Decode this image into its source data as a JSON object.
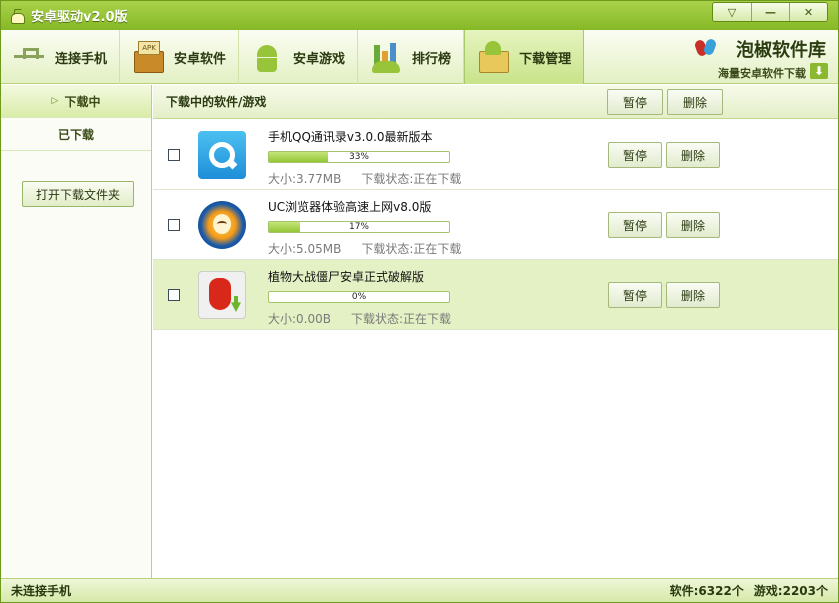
{
  "window": {
    "title": "安卓驱动v2.0版",
    "controls": [
      "▽",
      "—",
      "✕"
    ]
  },
  "toolbar": {
    "items": [
      {
        "label": "连接手机",
        "icon": "usb-icon"
      },
      {
        "label": "安卓软件",
        "icon": "apk-box-icon"
      },
      {
        "label": "安卓游戏",
        "icon": "android-game-icon"
      },
      {
        "label": "排行榜",
        "icon": "ranking-icon"
      },
      {
        "label": "下载管理",
        "icon": "download-folder-icon",
        "active": true
      }
    ]
  },
  "brand": {
    "name": "泡椒软件库",
    "tagline": "海量安卓软件下载",
    "download_glyph": "⬇"
  },
  "sidebar": {
    "arrow": "▷",
    "tabs": [
      {
        "label": "下载中",
        "active": true
      },
      {
        "label": "已下载",
        "active": false
      }
    ],
    "open_folder_label": "打开下载文件夹"
  },
  "main": {
    "title": "下载中的软件/游戏",
    "pause_label": "暂停",
    "delete_label": "删除",
    "downloads": [
      {
        "name": "手机QQ通讯录v3.0.0最新版本",
        "progress": 33,
        "progress_text": "33%",
        "size": "大小:3.77MB",
        "status": "下载状态:正在下载",
        "icon": "qq-contacts-icon",
        "highlighted": false
      },
      {
        "name": "UC浏览器体验高速上网v8.0版",
        "progress": 17,
        "progress_text": "17%",
        "size": "大小:5.05MB",
        "status": "下载状态:正在下载",
        "icon": "uc-browser-icon",
        "highlighted": false
      },
      {
        "name": "植物大战僵尸安卓正式破解版",
        "progress": 0,
        "progress_text": "0%",
        "size": "大小:0.00B",
        "status": "下载状态:正在下载",
        "icon": "plants-vs-zombies-icon",
        "highlighted": true
      }
    ]
  },
  "statusbar": {
    "left": "未连接手机",
    "software_count": "软件:6322个",
    "game_count": "游戏:2203个"
  },
  "colors": {
    "accent": "#86b826",
    "highlight_row": "#e4f1c4",
    "progress_fill": "#94c636"
  }
}
